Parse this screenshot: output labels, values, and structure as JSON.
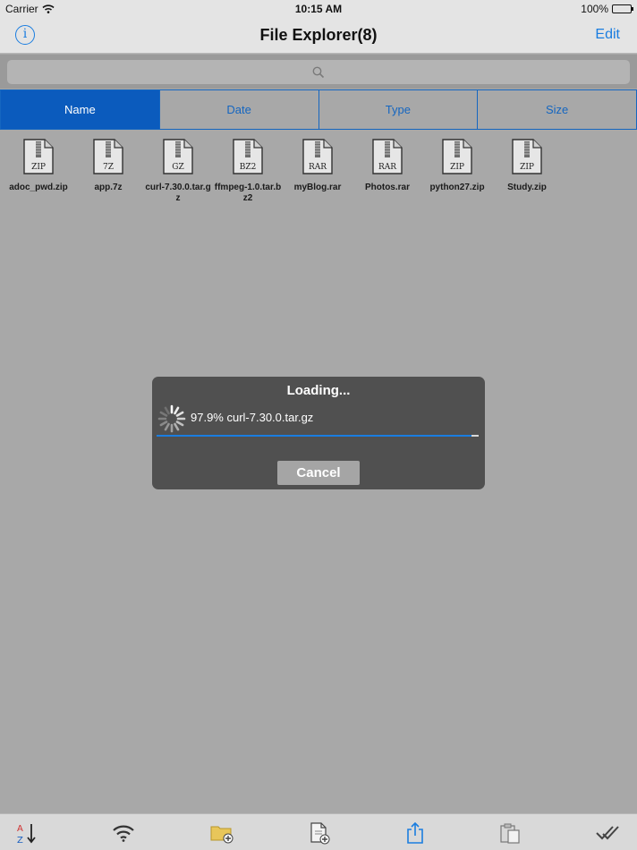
{
  "status_bar": {
    "carrier": "Carrier",
    "time": "10:15 AM",
    "battery": "100%"
  },
  "nav_bar": {
    "title": "File Explorer(8)",
    "info_icon": "info-icon",
    "edit_label": "Edit"
  },
  "search": {
    "icon": "search-icon",
    "placeholder": ""
  },
  "sort_tabs": [
    {
      "label": "Name",
      "active": true
    },
    {
      "label": "Date",
      "active": false
    },
    {
      "label": "Type",
      "active": false
    },
    {
      "label": "Size",
      "active": false
    }
  ],
  "files": [
    {
      "name": "adoc_pwd.zip",
      "type_label": "ZIP"
    },
    {
      "name": "app.7z",
      "type_label": "7Z"
    },
    {
      "name": "curl-7.30.0.tar.gz",
      "type_label": "GZ"
    },
    {
      "name": "ffmpeg-1.0.tar.bz2",
      "type_label": "BZ2"
    },
    {
      "name": "myBlog.rar",
      "type_label": "RAR"
    },
    {
      "name": "Photos.rar",
      "type_label": "RAR"
    },
    {
      "name": "python27.zip",
      "type_label": "ZIP"
    },
    {
      "name": "Study.zip",
      "type_label": "ZIP"
    }
  ],
  "loading_dialog": {
    "title": "Loading...",
    "status": "97.9% curl-7.30.0.tar.gz",
    "progress": 0.979,
    "cancel_label": "Cancel"
  },
  "toolbar": {
    "items": [
      "sort-az-icon",
      "wifi-icon",
      "new-folder-icon",
      "new-file-icon",
      "share-icon",
      "paste-icon",
      "select-all-icon"
    ]
  },
  "colors": {
    "accent": "#1a7de0",
    "active_tab": "#0b5bbd",
    "dialog_bg": "#505050",
    "overlay": "#a8a8a8"
  }
}
